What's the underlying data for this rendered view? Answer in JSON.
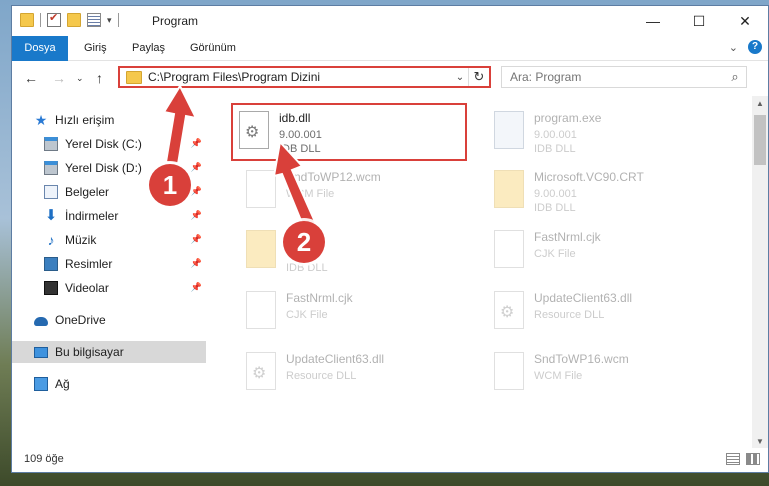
{
  "window": {
    "title": "Program",
    "controls": {
      "minimize": "—",
      "maximize": "☐",
      "close": "✕"
    }
  },
  "ribbon": {
    "tabs": [
      "Dosya",
      "Giriş",
      "Paylaş",
      "Görünüm"
    ],
    "expand_icon": "chevron-down-icon",
    "help": "?"
  },
  "nav": {
    "address": "C:\\Program Files\\Program Dizini",
    "search_placeholder": "Ara: Program"
  },
  "sidebar": {
    "items": [
      {
        "label": "Hızlı erişim",
        "icon": "star-icon"
      },
      {
        "label": "Yerel Disk (C:)",
        "icon": "disk-icon",
        "pinned": true
      },
      {
        "label": "Yerel Disk (D:)",
        "icon": "disk-icon",
        "pinned": true
      },
      {
        "label": "Belgeler",
        "icon": "document-icon",
        "pinned": true
      },
      {
        "label": "İndirmeler",
        "icon": "download-icon",
        "pinned": true
      },
      {
        "label": "Müzik",
        "icon": "music-icon",
        "pinned": true
      },
      {
        "label": "Resimler",
        "icon": "pictures-icon",
        "pinned": true
      },
      {
        "label": "Videolar",
        "icon": "video-icon",
        "pinned": true
      },
      {
        "label": "OneDrive",
        "icon": "cloud-icon"
      },
      {
        "label": "Bu bilgisayar",
        "icon": "computer-icon",
        "selected": true
      },
      {
        "label": "Ağ",
        "icon": "network-icon"
      }
    ]
  },
  "files": [
    {
      "name": "idb.dll",
      "line2": "9.00.001",
      "line3": "IDB DLL",
      "icon": "dll-icon",
      "highlighted": true
    },
    {
      "name": "program.exe",
      "line2": "9.00.001",
      "line3": "IDB DLL",
      "icon": "exe-icon"
    },
    {
      "name": "SndToWP12.wcm",
      "line2": "WCM File",
      "line3": "",
      "icon": "file-icon"
    },
    {
      "name": "Microsoft.VC90.CRT",
      "line2": "9.00.001",
      "line3": "IDB DLL",
      "icon": "folder-icon"
    },
    {
      "name": "",
      "line2": "",
      "line3": "IDB DLL",
      "icon": "folder-icon"
    },
    {
      "name": "FastNrml.cjk",
      "line2": "CJK File",
      "line3": "",
      "icon": "file-icon"
    },
    {
      "name": "FastNrml.cjk",
      "line2": "CJK File",
      "line3": "",
      "icon": "file-icon"
    },
    {
      "name": "UpdateClient63.dll",
      "line2": "Resource DLL",
      "line3": "",
      "icon": "dll-icon"
    },
    {
      "name": "UpdateClient63.dll",
      "line2": "Resource DLL",
      "line3": "",
      "icon": "dll-icon"
    },
    {
      "name": "SndToWP16.wcm",
      "line2": "WCM File",
      "line3": "",
      "icon": "file-icon"
    }
  ],
  "status": {
    "count": "109 öğe"
  },
  "annotations": {
    "step1": "1",
    "step2": "2"
  },
  "colors": {
    "accent": "#1979ca",
    "highlight": "#d9403a"
  }
}
